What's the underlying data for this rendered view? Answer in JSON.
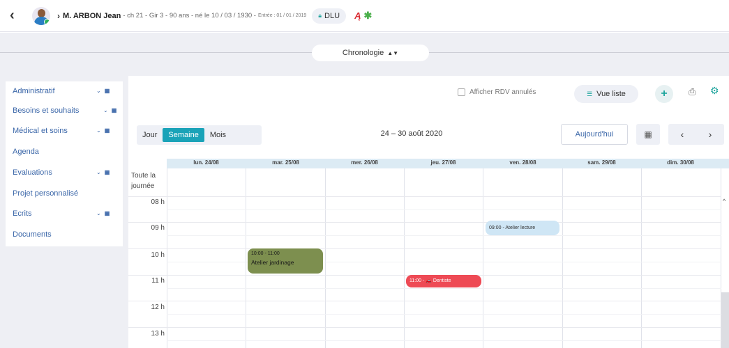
{
  "header": {
    "patient_name": "M. ARBON Jean",
    "patient_info": "- ch 21 - Gir 3 - 90 ans - né le 10 / 03 / 1930 -",
    "entree": "Entrée : 01 / 01 / 2019",
    "dlu_label": "DLU"
  },
  "chronologie": {
    "label": "Chronologie"
  },
  "sidebar": {
    "items": [
      {
        "label": "Administratif",
        "expandable": true
      },
      {
        "label": "Besoins et souhaits",
        "expandable": true
      },
      {
        "label": "Médical et soins",
        "expandable": true
      },
      {
        "label": "Agenda",
        "expandable": false
      },
      {
        "label": "Evaluations",
        "expandable": true
      },
      {
        "label": "Projet personnalisé",
        "expandable": false
      },
      {
        "label": "Ecrits",
        "expandable": true
      },
      {
        "label": "Documents",
        "expandable": false
      }
    ]
  },
  "toolbar": {
    "show_cancelled_label": "Afficher RDV annulés",
    "list_view_label": "Vue liste",
    "add_symbol": "+"
  },
  "calendar": {
    "views": [
      "Jour",
      "Semaine",
      "Mois"
    ],
    "active_view": "Semaine",
    "date_range": "24 – 30 août 2020",
    "today_label": "Aujourd'hui",
    "days": [
      "lun. 24/08",
      "mar. 25/08",
      "mer. 26/08",
      "jeu. 27/08",
      "ven. 28/08",
      "sam. 29/08",
      "dim. 30/08"
    ],
    "allday_label": [
      "Toute la",
      "journée"
    ],
    "hours": [
      "08 h",
      "09 h",
      "10 h",
      "11 h",
      "12 h",
      "13 h"
    ],
    "events": {
      "lecture": {
        "text": "09:00 - Atelier lecture",
        "color": "#cfe6f5"
      },
      "jardinage": {
        "time": "10:00 - 11:00",
        "title": "Atelier jardinage",
        "color": "#7d8f4f"
      },
      "dentiste": {
        "text": "11:00 - 🚗 Dentiste",
        "color": "#ee4a55"
      }
    }
  },
  "colors": {
    "accent": "#1aa3b8",
    "link": "#3a66a8",
    "teal": "#1aa39b"
  }
}
